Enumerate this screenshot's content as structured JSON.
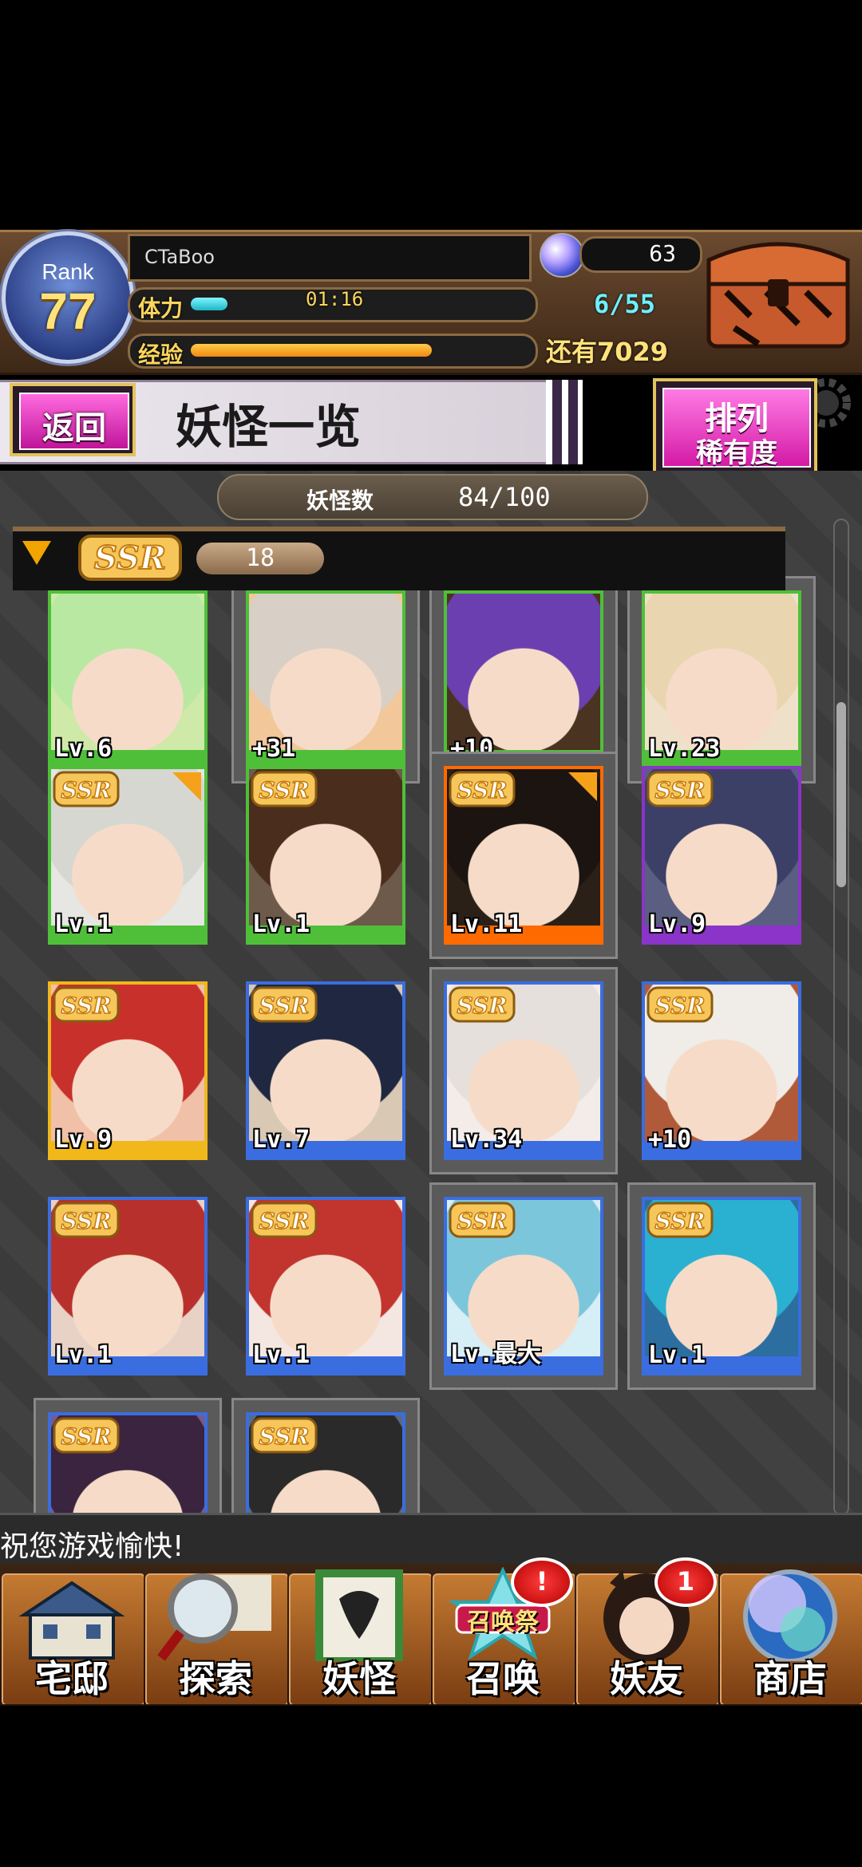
{
  "player": {
    "rank_label": "Rank",
    "rank": "77",
    "name": "CTaBoo",
    "stamina_label": "体力",
    "stamina_timer": "01:16",
    "stamina_value": "6/55",
    "stamina_fraction": 0.109,
    "exp_label": "经验",
    "exp_fraction": 0.72,
    "exp_remaining": "还有7029",
    "orbs": "63"
  },
  "title_bar": {
    "back_label": "返回",
    "title": "妖怪一览",
    "sort_label": "排列",
    "sort_value": "稀有度"
  },
  "list": {
    "count_label": "妖怪数",
    "count_value": "84/100",
    "group_rarity": "SSR",
    "group_count": "18"
  },
  "cards": [
    {
      "level": "Lv.6",
      "frame": "#4fbf3a",
      "bg": "#cfe9a8",
      "hair": "#b9e8a2",
      "framed": false,
      "badge": false,
      "star": false
    },
    {
      "level": "+31",
      "frame": "#4fbf3a",
      "bg": "#f2c79a",
      "hair": "#d8d0c6",
      "framed": true,
      "badge": false,
      "star": false
    },
    {
      "level": "+10",
      "frame": "#4fbf3a",
      "bg": "#4a3320",
      "hair": "#6c3fb0",
      "framed": true,
      "badge": false,
      "star": false
    },
    {
      "level": "Lv.23",
      "frame": "#4fbf3a",
      "bg": "#efe1c9",
      "hair": "#e9d6b0",
      "framed": true,
      "badge": false,
      "star": false
    },
    {
      "level": "Lv.1",
      "frame": "#4fbf3a",
      "bg": "#e6e6e2",
      "hair": "#d7d7d2",
      "framed": false,
      "badge": true,
      "star": true
    },
    {
      "level": "Lv.1",
      "frame": "#4fbf3a",
      "bg": "#6e5a4a",
      "hair": "#4a2d1c",
      "framed": false,
      "badge": true,
      "star": false
    },
    {
      "level": "Lv.11",
      "frame": "#ff6a00",
      "bg": "#2a2018",
      "hair": "#1b1410",
      "framed": true,
      "badge": true,
      "star": true
    },
    {
      "level": "Lv.9",
      "frame": "#8a34c9",
      "bg": "#5a5e80",
      "hair": "#3c3f66",
      "framed": false,
      "badge": true,
      "star": false
    },
    {
      "level": "Lv.9",
      "frame": "#f0b81a",
      "bg": "#f0c0a8",
      "hair": "#c8302c",
      "framed": false,
      "badge": true,
      "star": false
    },
    {
      "level": "Lv.7",
      "frame": "#3a6de0",
      "bg": "#d8c8b4",
      "hair": "#1f2840",
      "framed": false,
      "badge": true,
      "star": false
    },
    {
      "level": "Lv.34",
      "frame": "#3a6de0",
      "bg": "#f3ece8",
      "hair": "#e6e0dc",
      "framed": true,
      "badge": true,
      "star": false
    },
    {
      "level": "+10",
      "frame": "#3a6de0",
      "bg": "#b05a3a",
      "hair": "#f0ece8",
      "framed": false,
      "badge": true,
      "star": false
    },
    {
      "level": "Lv.1",
      "frame": "#3a6de0",
      "bg": "#e8d2c6",
      "hair": "#b8302c",
      "framed": false,
      "badge": true,
      "star": false
    },
    {
      "level": "Lv.1",
      "frame": "#3a6de0",
      "bg": "#f4e6e0",
      "hair": "#c2342e",
      "framed": false,
      "badge": true,
      "star": false
    },
    {
      "level": "Lv.最大",
      "frame": "#3a6de0",
      "bg": "#d6eef6",
      "hair": "#7cc6dc",
      "framed": true,
      "badge": true,
      "star": false
    },
    {
      "level": "Lv.1",
      "frame": "#3a6de0",
      "bg": "#2c6ea0",
      "hair": "#2ab0d0",
      "framed": true,
      "badge": true,
      "star": false
    },
    {
      "level": "",
      "frame": "#3a6de0",
      "bg": "#7a5a8a",
      "hair": "#3a2440",
      "framed": true,
      "badge": true,
      "star": false
    },
    {
      "level": "",
      "frame": "#3a6de0",
      "bg": "#5a6a80",
      "hair": "#2a2a2a",
      "framed": true,
      "badge": true,
      "star": false
    }
  ],
  "ticker": "祝您游戏愉快!",
  "nav": [
    {
      "label": "宅邸",
      "icon": "mansion-icon",
      "badge": ""
    },
    {
      "label": "探索",
      "icon": "magnifier-map-icon",
      "badge": ""
    },
    {
      "label": "妖怪",
      "icon": "scroll-icon",
      "badge": ""
    },
    {
      "label": "召唤",
      "icon": "summon-festival-icon",
      "badge": "!",
      "sub": "召唤祭"
    },
    {
      "label": "妖友",
      "icon": "friend-avatar-icon",
      "badge": "1"
    },
    {
      "label": "商店",
      "icon": "crystal-orb-icon",
      "badge": ""
    }
  ],
  "colors": {
    "ssr_gold": "#f2a400",
    "pink_button": "#e13bb8",
    "header_brown": "#5a3a22"
  }
}
